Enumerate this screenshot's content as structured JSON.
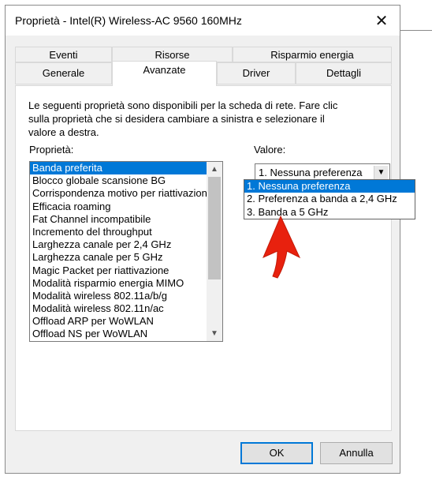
{
  "window": {
    "title": "Proprietà - Intel(R) Wireless-AC 9560 160MHz",
    "close_glyph": "✕"
  },
  "tabs": {
    "row1": [
      "Eventi",
      "Risorse",
      "Risparmio energia"
    ],
    "row2": [
      "Generale",
      "Avanzate",
      "Driver",
      "Dettagli"
    ],
    "active": "Avanzate"
  },
  "panel": {
    "description": "Le seguenti proprietà sono disponibili per la scheda di rete. Fare clic sulla proprietà che si desidera cambiare a sinistra e selezionare il valore a destra.",
    "property_label": "Proprietà:",
    "value_label": "Valore:",
    "properties": [
      "Banda preferita",
      "Blocco globale scansione BG",
      "Corrispondenza motivo per riattivazione",
      "Efficacia roaming",
      "Fat Channel incompatibile",
      "Incremento del throughput",
      "Larghezza canale per 2,4 GHz",
      "Larghezza canale per 5 GHz",
      "Magic Packet per riattivazione",
      "Modalità risparmio energia MIMO",
      "Modalità wireless 802.11a/b/g",
      "Modalità wireless 802.11n/ac",
      "Offload ARP per WoWLAN",
      "Offload NS per WoWLAN"
    ],
    "selected_property": "Banda preferita",
    "value": {
      "current": "1. Nessuna preferenza",
      "options": [
        "1. Nessuna preferenza",
        "2. Preferenza a banda a 2,4 GHz",
        "3. Banda a 5 GHz"
      ]
    }
  },
  "buttons": {
    "ok": "OK",
    "cancel": "Annulla"
  },
  "colors": {
    "selection": "#0078d7",
    "annotation_arrow": "#e8210e"
  },
  "icons": {
    "scroll_up": "▲",
    "scroll_down": "▼",
    "combo_arrow": "▼"
  }
}
